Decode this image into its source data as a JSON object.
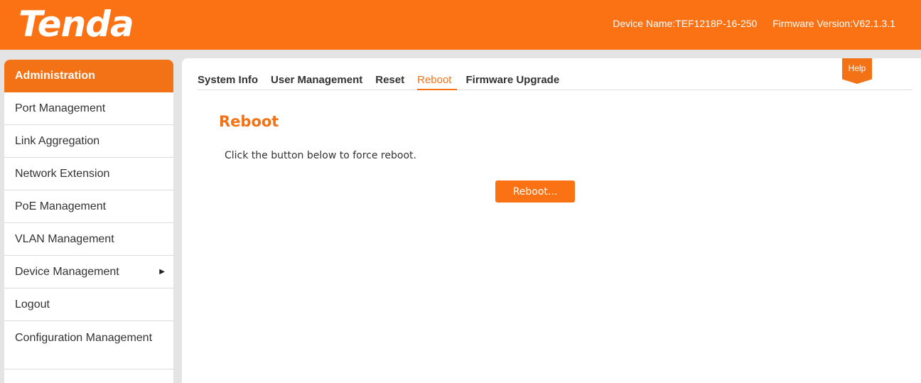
{
  "header": {
    "logo_text": "Tenda",
    "device_name": "Device Name:TEF1218P-16-250",
    "firmware_version": "Firmware Version:V62.1.3.1"
  },
  "sidebar": {
    "items": [
      {
        "label": "Administration",
        "active": true
      },
      {
        "label": "Port Management"
      },
      {
        "label": "Link Aggregation"
      },
      {
        "label": "Network Extension"
      },
      {
        "label": "PoE Management"
      },
      {
        "label": "VLAN Management"
      },
      {
        "label": "Device Management",
        "has_submenu": true
      },
      {
        "label": "Logout"
      },
      {
        "label": "Configuration Management"
      }
    ],
    "submenu_arrow": "▶"
  },
  "tabs": [
    {
      "label": "System Info"
    },
    {
      "label": "User Management"
    },
    {
      "label": "Reset"
    },
    {
      "label": "Reboot",
      "active": true
    },
    {
      "label": "Firmware Upgrade"
    }
  ],
  "help": {
    "label": "Help"
  },
  "content": {
    "title": "Reboot",
    "description": "Click the button below to force reboot.",
    "button_label": "Reboot..."
  },
  "colors": {
    "brand_orange": "#fb7215",
    "active_orange": "#f47216"
  },
  "icons": {
    "submenu_arrow": "right-triangle-icon"
  }
}
